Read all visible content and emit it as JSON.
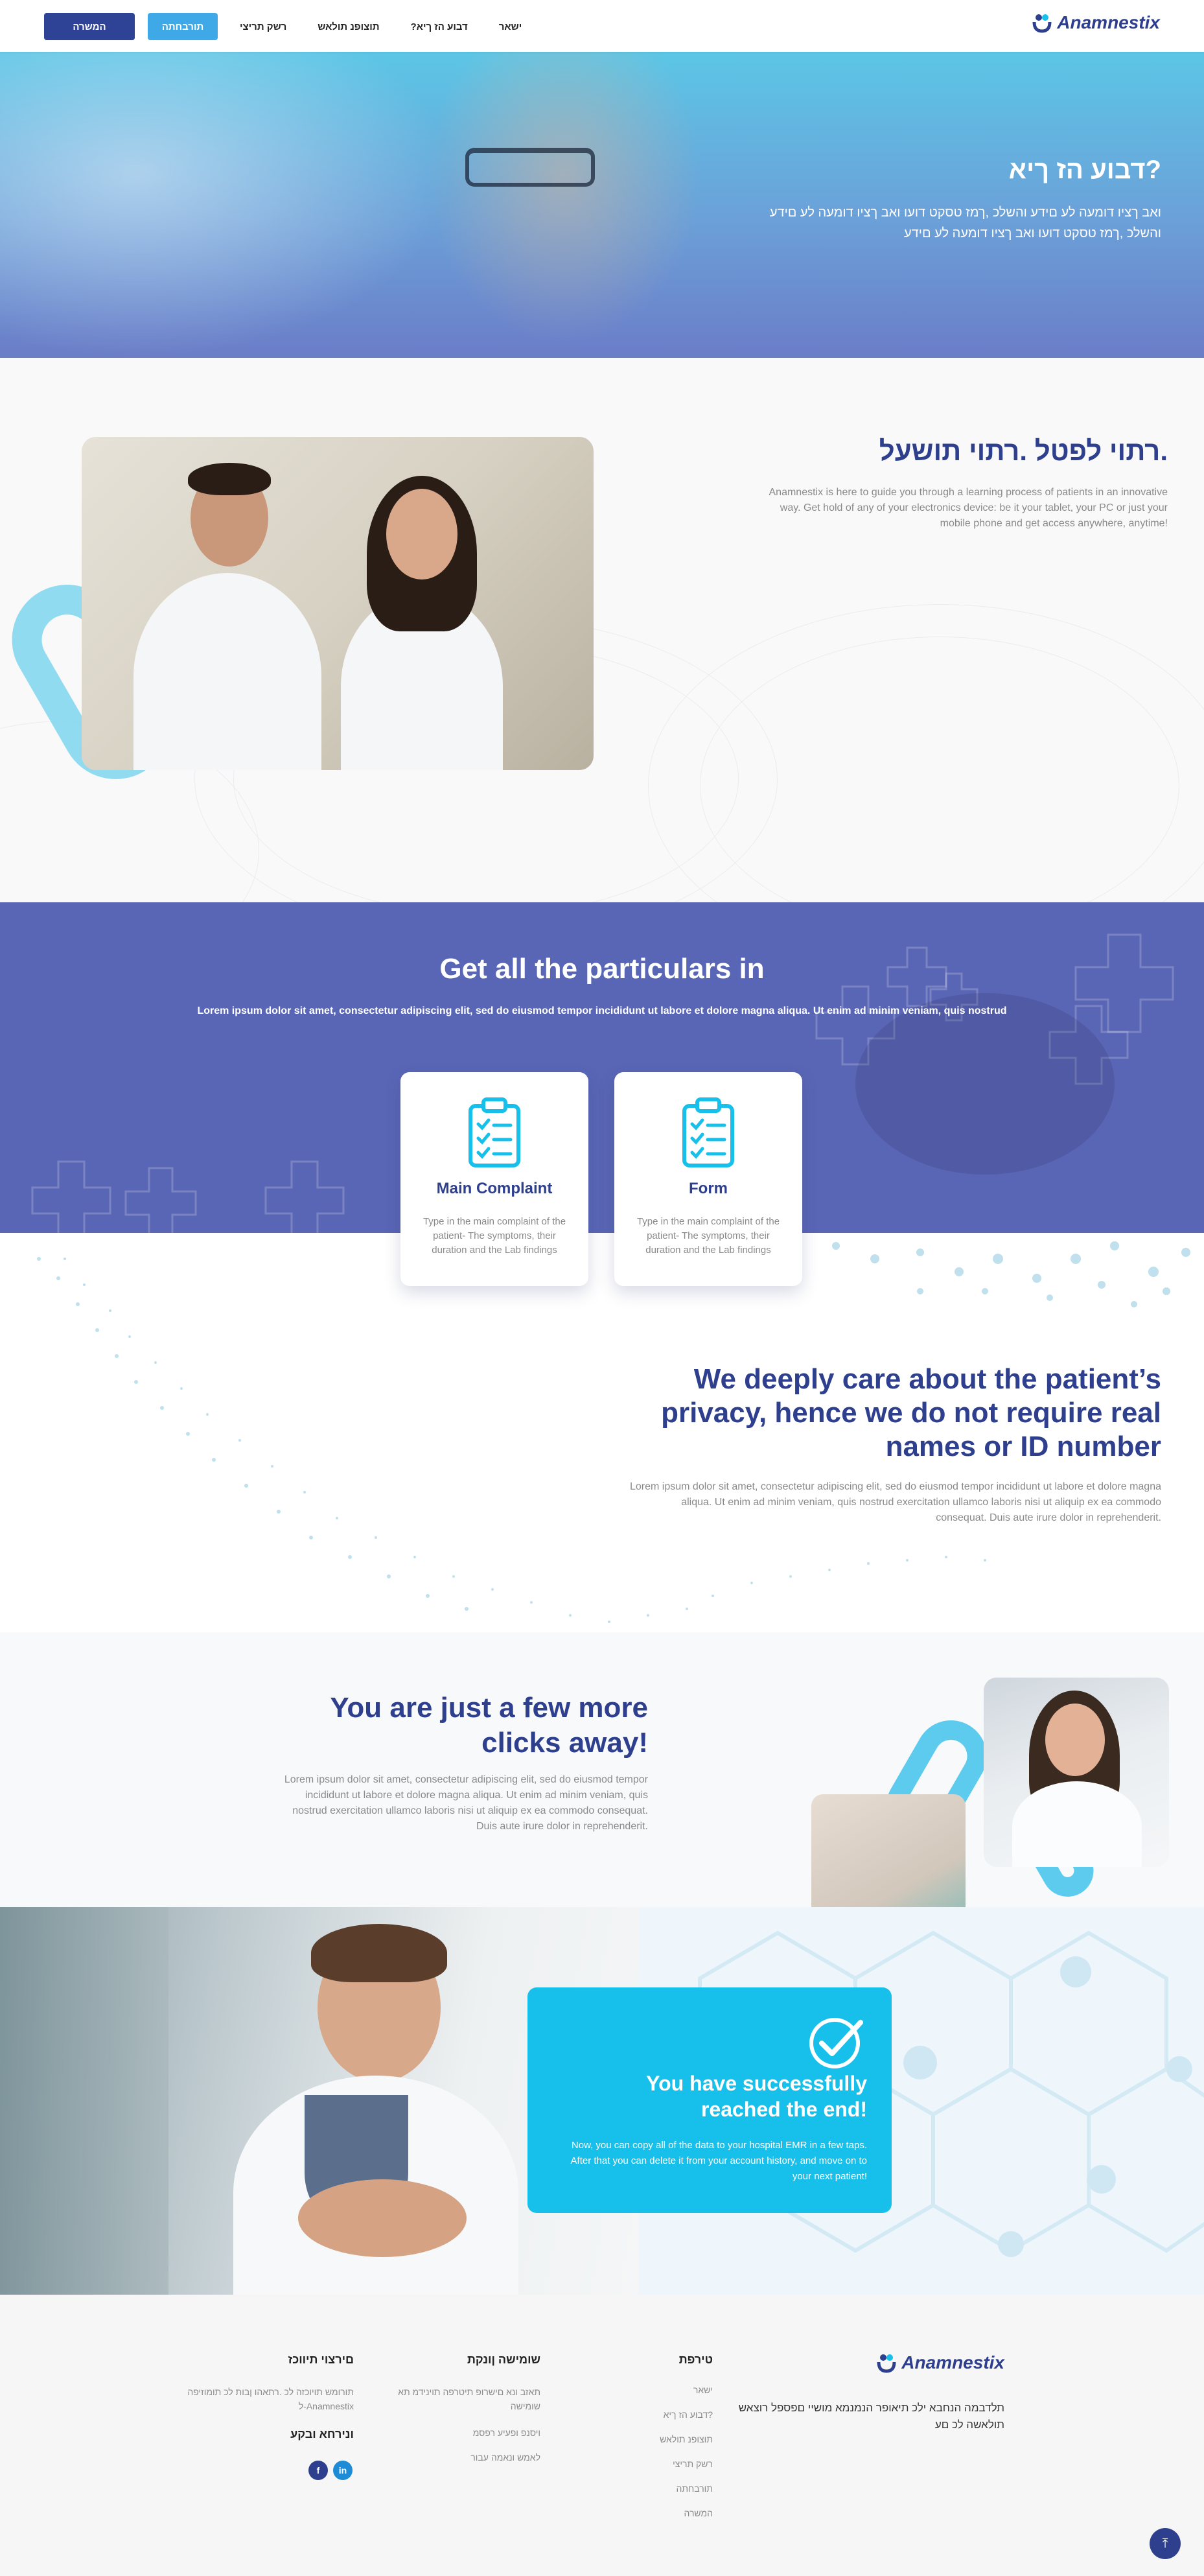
{
  "header": {
    "logo_text": "Anamnestix",
    "signup_label": "המשרה",
    "login_label": "תורבחתה",
    "nav": [
      "רשק תריצי",
      "תוצופנ תולאש",
      "?דבוע הז ךיא",
      "ישאר"
    ]
  },
  "hero": {
    "title": "?דבוע הז ךיא",
    "subtitle": "ואב ךציו דומעה לע םידע והשלכ ,ךמז טסקט דועו ואב ךציו דומעה לע םידע והשלכ ,ךמז טסקט דועו ואב ךציו דומעה לע םידע"
  },
  "section2": {
    "title": ".רתוי לפטל .רתוי תושעל",
    "text": "Anamnestix is here to guide you through a learning process of patients in an innovative way. Get hold of any of your electronics device: be it your tablet, your PC or just your mobile phone and get access anywhere, anytime!"
  },
  "section3": {
    "title": "Get all the particulars in",
    "subtitle": "Lorem ipsum dolor sit amet, consectetur adipiscing elit, sed do eiusmod tempor incididunt ut labore et dolore magna aliqua. Ut enim ad minim veniam, quis nostrud",
    "cards": [
      {
        "title": "Main Complaint",
        "text": "Type in the main complaint of the patient- The symptoms, their duration and the Lab findings",
        "icon": "clipboard-check-icon"
      },
      {
        "title": "Form",
        "text": "Type in the main complaint of the patient- The symptoms, their duration and the Lab findings",
        "icon": "clipboard-check-icon"
      }
    ]
  },
  "section4": {
    "title": "We deeply care about the patient’s privacy, hence we do not require real names or ID number",
    "text": "Lorem ipsum dolor sit amet, consectetur adipiscing elit, sed do eiusmod tempor incididunt ut labore et dolore magna aliqua. Ut enim ad minim veniam, quis nostrud exercitation ullamco laboris nisi ut aliquip ex ea commodo consequat. Duis aute irure dolor in reprehenderit."
  },
  "section5": {
    "title": "You are just a few more clicks away!",
    "text": "Lorem ipsum dolor sit amet, consectetur adipiscing elit, sed do eiusmod tempor incididunt ut labore et dolore magna aliqua. Ut enim ad minim veniam, quis nostrud exercitation ullamco laboris nisi ut aliquip ex ea commodo consequat. Duis aute irure dolor in reprehenderit."
  },
  "section6": {
    "title": "You have successfully reached the end!",
    "text": "Now, you can copy all of the data to your hospital EMR in a few taps. After that you can delete it from your account history, and move on to your next patient!"
  },
  "footer": {
    "logo_text": "Anamnestix",
    "description": "תלדבמה הנחבא ילכ תיאופר הנמנמא מושיי םפספל רוצאש תולאשה לכ םע",
    "nav_head": "טירפת",
    "nav_items": [
      "ישאר",
      "?דבוע הז ךיא",
      "תוצופנ תולאש",
      "רשק תריצי",
      "תורבחתה",
      "המשרה"
    ],
    "legal_head": "שומישה ןונקת",
    "legal_items": [
      "תאזב ונא םישרופ תיטרפה תוינידמ תא שומישה",
      "ויסנפ ופעיע רפסמ",
      "לאמש ונאמה עבור"
    ],
    "contact_head": "םירצוי תיווכז",
    "contact_text": "תורומש תויוכזה לכ .רתאהו ןבות לכ תומוזיפה Anamnestix-ל",
    "follow_head": "ונירחא ובקע",
    "socials": [
      "facebook-icon",
      "linkedin-icon"
    ],
    "scroll_label": "⤒"
  },
  "colors": {
    "primary": "#2e3f8e",
    "accent": "#16c0ea",
    "purple": "#5966b5",
    "login": "#3fa9e8"
  }
}
